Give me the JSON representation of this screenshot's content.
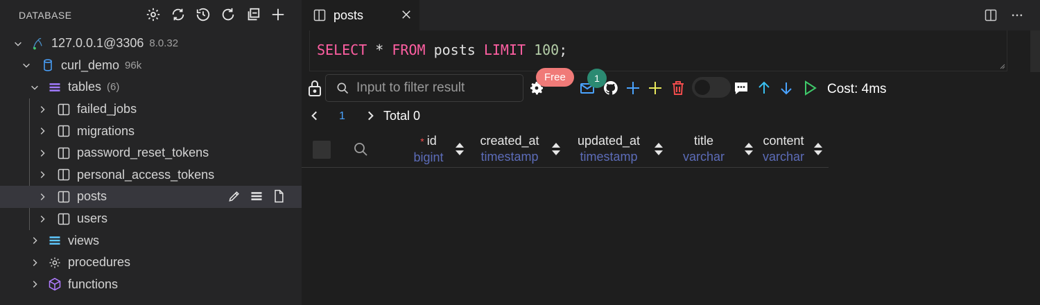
{
  "sidebar": {
    "title": "DATABASE",
    "connection": {
      "label": "127.0.0.1@3306",
      "version": "8.0.32"
    },
    "database": {
      "label": "curl_demo",
      "size": "96k"
    },
    "tables_group": {
      "label": "tables",
      "count": "(6)"
    },
    "tables": [
      "failed_jobs",
      "migrations",
      "password_reset_tokens",
      "personal_access_tokens",
      "posts",
      "users"
    ],
    "views": "views",
    "procedures": "procedures",
    "functions": "functions"
  },
  "tab": {
    "label": "posts"
  },
  "query": {
    "select": "SELECT",
    "star": " * ",
    "from": "FROM",
    "table": " posts ",
    "limit": "LIMIT",
    "num": " 100",
    "end": ";"
  },
  "toolbar": {
    "filter_placeholder": "Input to filter result",
    "free_badge": "Free",
    "count_badge": "1",
    "cost": "Cost: 4ms"
  },
  "pager": {
    "page": "1",
    "total": "Total 0"
  },
  "columns": [
    {
      "name": "id",
      "type": "bigint",
      "required": "*"
    },
    {
      "name": "created_at",
      "type": "timestamp"
    },
    {
      "name": "updated_at",
      "type": "timestamp"
    },
    {
      "name": "title",
      "type": "varchar"
    },
    {
      "name": "content",
      "type": "varchar"
    }
  ],
  "colors": {
    "accent": "#4aa3ff",
    "keyword": "#ff5fa2",
    "type": "#5c6cb8",
    "badge": "#f07a78"
  }
}
